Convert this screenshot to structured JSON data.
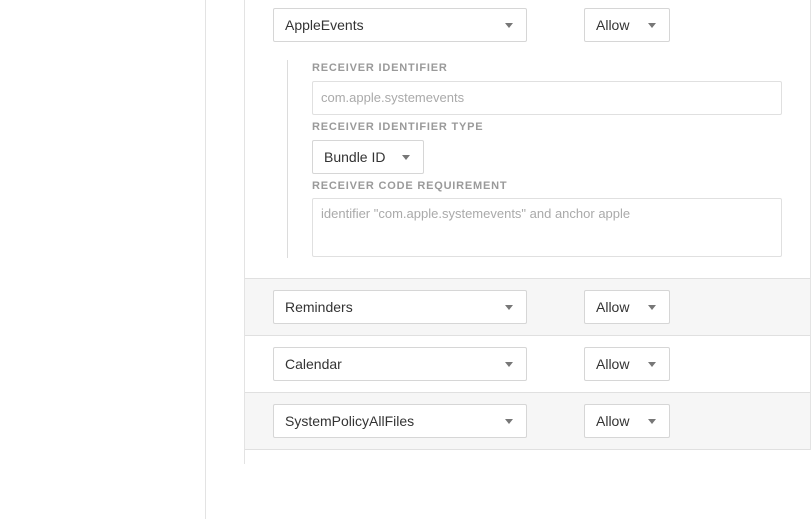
{
  "services": [
    {
      "service": "AppleEvents",
      "permission": "Allow"
    },
    {
      "service": "Reminders",
      "permission": "Allow"
    },
    {
      "service": "Calendar",
      "permission": "Allow"
    },
    {
      "service": "SystemPolicyAllFiles",
      "permission": "Allow"
    }
  ],
  "apple_events_detail": {
    "receiver_identifier_label": "RECEIVER IDENTIFIER",
    "receiver_identifier_placeholder": "com.apple.systemevents",
    "receiver_identifier_type_label": "RECEIVER IDENTIFIER TYPE",
    "receiver_identifier_type_value": "Bundle ID",
    "receiver_code_requirement_label": "RECEIVER CODE REQUIREMENT",
    "receiver_code_requirement_placeholder": "identifier \"com.apple.systemevents\" and anchor apple"
  },
  "colors": {
    "row_alt_background": "#f6f6f6",
    "border": "#d6d6d6",
    "label": "#9a9a9a",
    "placeholder": "#aaaaaa"
  }
}
